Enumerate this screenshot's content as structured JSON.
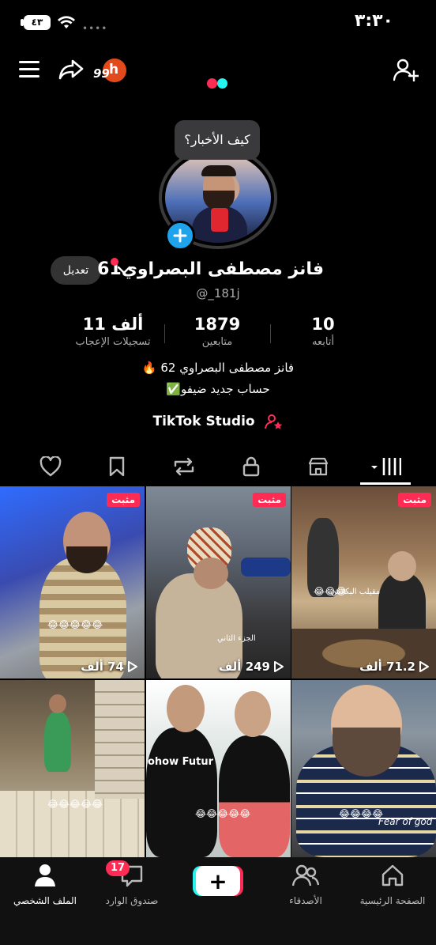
{
  "status_bar": {
    "time": "٣:٣٠",
    "battery": "٤٣"
  },
  "profile": {
    "status_bubble": "كيف الأخبار؟",
    "display_name": "فانز مصطفى البصراوي61",
    "username": "@_181j",
    "edit_label": "تعديل",
    "stats": [
      {
        "value": "10",
        "label": "أتابعه"
      },
      {
        "value": "1879",
        "label": "متابعين"
      },
      {
        "value": "11 ألف",
        "label": "تسجيلات الإعجاب"
      }
    ],
    "bio_line1": "فانز مصطفى البصراوي 62 🔥",
    "bio_line2": "حساب جديد ضيفو✅",
    "studio_link": "TikTok Studio"
  },
  "coins": {
    "count": "99",
    "letter": "h"
  },
  "videos": [
    {
      "pinned_label": "مثبت",
      "views": "74 ألف"
    },
    {
      "pinned_label": "مثبت",
      "views": "249 ألف",
      "overlay_text": "الجزء الثاني"
    },
    {
      "pinned_label": "مثبت",
      "views": "71.2 ألف",
      "overlay_text": "مقيلب البكلاش"
    },
    {
      "pinned_label": "",
      "views": ""
    },
    {
      "pinned_label": "",
      "views": "",
      "overlay_text": "ohow Futur"
    },
    {
      "pinned_label": "",
      "views": "",
      "overlay_text": "Fear of god"
    }
  ],
  "bottom_nav": {
    "profile": "الملف الشخصي",
    "inbox": "صندوق الوارد",
    "inbox_badge": "17",
    "friends": "الأصدقاء",
    "home": "الصفحة الرئيسية",
    "create": "+"
  }
}
